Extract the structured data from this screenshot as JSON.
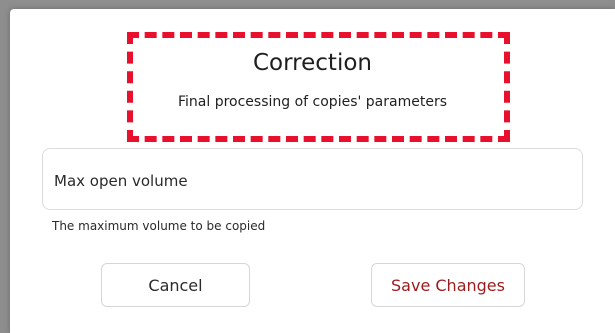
{
  "dialog": {
    "title": "Correction",
    "subtitle": "Final processing of copies' parameters",
    "field": {
      "label": "Max open volume",
      "helper": "The maximum volume to be copied"
    },
    "buttons": {
      "cancel": "Cancel",
      "save": "Save Changes"
    }
  },
  "colors": {
    "highlight": "#e8102c",
    "save_text": "#9b1b1b",
    "backdrop": "#8e8e8e"
  }
}
